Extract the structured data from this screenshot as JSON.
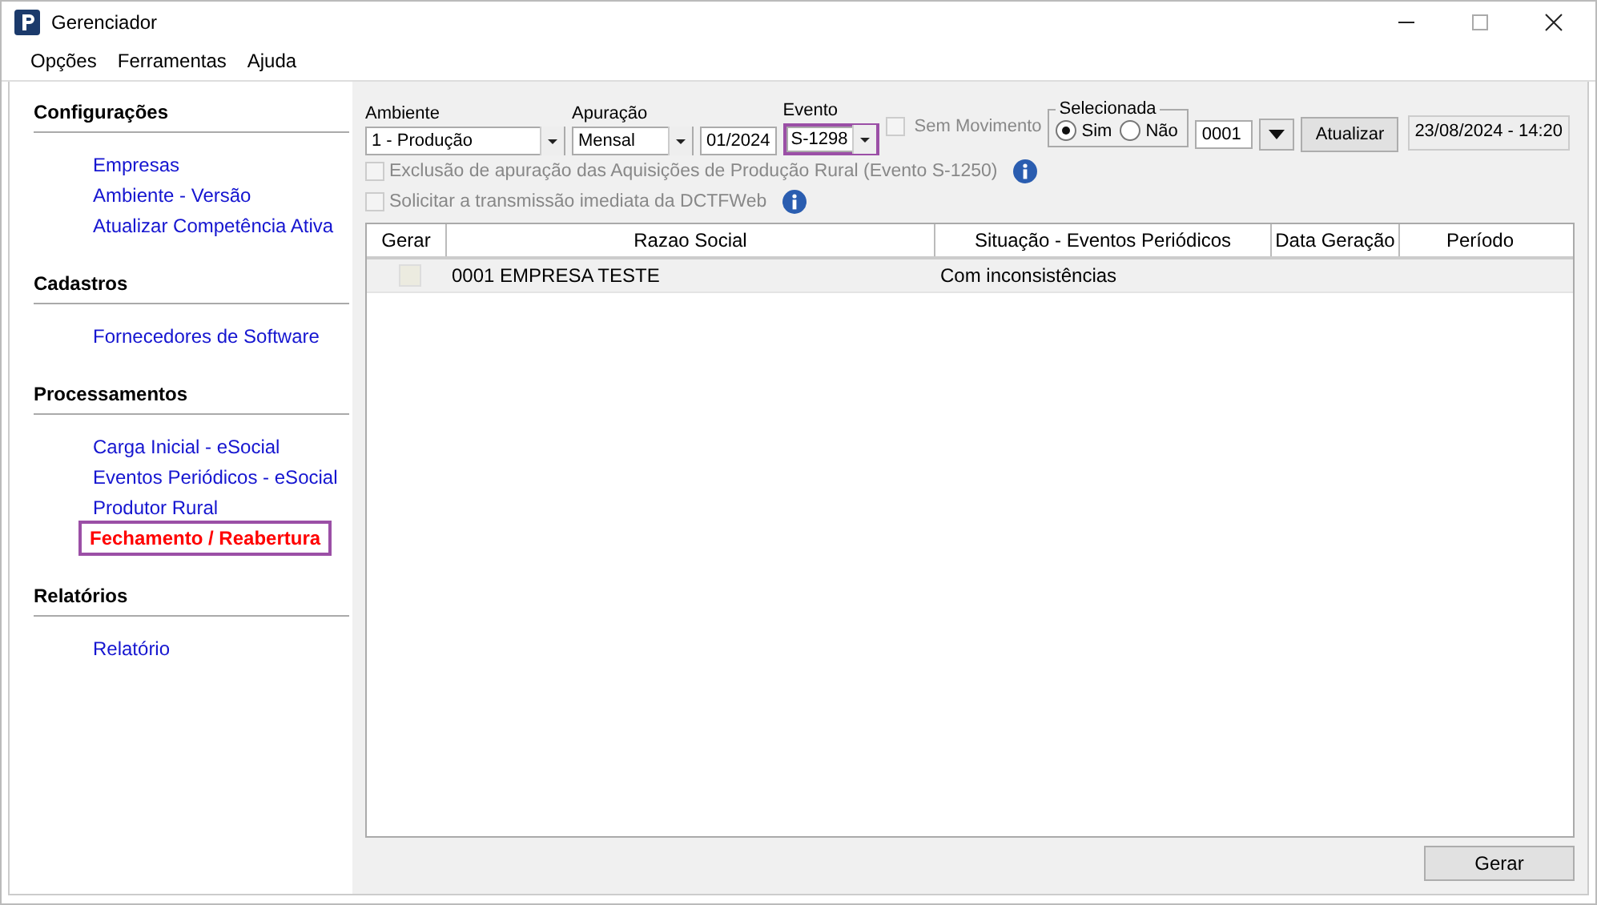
{
  "window": {
    "title": "Gerenciador"
  },
  "menu": [
    "Opções",
    "Ferramentas",
    "Ajuda"
  ],
  "sidebar": [
    {
      "title": "Configurações",
      "items": [
        {
          "label": "Empresas",
          "selected": false,
          "highlighted": false
        },
        {
          "label": "Ambiente - Versão",
          "selected": false,
          "highlighted": false
        },
        {
          "label": "Atualizar Competência Ativa",
          "selected": false,
          "highlighted": false
        }
      ]
    },
    {
      "title": "Cadastros",
      "items": [
        {
          "label": "Fornecedores de Software",
          "selected": false,
          "highlighted": false
        }
      ]
    },
    {
      "title": "Processamentos",
      "items": [
        {
          "label": "Carga Inicial - eSocial",
          "selected": false,
          "highlighted": false
        },
        {
          "label": "Eventos Periódicos - eSocial",
          "selected": false,
          "highlighted": false
        },
        {
          "label": "Produtor Rural",
          "selected": false,
          "highlighted": false
        },
        {
          "label": "Fechamento / Reabertura",
          "selected": true,
          "highlighted": true
        }
      ]
    },
    {
      "title": "Relatórios",
      "items": [
        {
          "label": "Relatório",
          "selected": false,
          "highlighted": false
        }
      ]
    }
  ],
  "filters": {
    "ambiente": {
      "label": "Ambiente",
      "value": "1 - Produção"
    },
    "apuracao": {
      "label": "Apuração",
      "value": "Mensal"
    },
    "competencia": {
      "value": "01/2024"
    },
    "evento": {
      "label": "Evento",
      "value": "S-1298",
      "highlighted": true
    },
    "sem_movimento": {
      "label": "Sem Movimento",
      "checked": false,
      "disabled": true
    },
    "selecionada": {
      "label": "Selecionada",
      "options": [
        {
          "label": "Sim",
          "selected": true
        },
        {
          "label": "Não",
          "selected": false
        }
      ]
    },
    "empresa": {
      "value": "0001"
    },
    "atualizar": "Atualizar",
    "timestamp": "23/08/2024 - 14:20"
  },
  "options": [
    {
      "label": "Exclusão de apuração das Aquisições de Produção Rural (Evento S-1250)",
      "checked": false,
      "disabled": true
    },
    {
      "label": "Solicitar a transmissão imediata da DCTFWeb",
      "checked": false,
      "disabled": true
    }
  ],
  "table": {
    "columns": [
      "Gerar",
      "Razao Social",
      "Situação - Eventos Periódicos",
      "Data Geração",
      "Período"
    ],
    "rows": [
      {
        "checked": false,
        "razao_social": "0001 EMPRESA TESTE",
        "situacao": "Com inconsistências"
      }
    ]
  },
  "buttons": [
    "Gerar"
  ]
}
